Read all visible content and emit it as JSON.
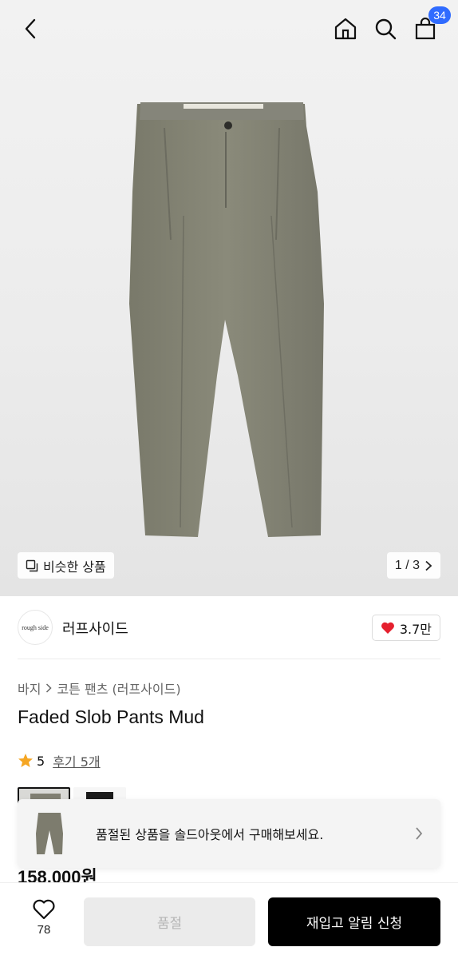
{
  "header": {
    "back_icon": "chevron-left-icon",
    "home_icon": "home-icon",
    "search_icon": "search-icon",
    "cart_icon": "shopping-bag-icon",
    "cart_count": "34"
  },
  "gallery": {
    "similar_label": "비슷한 상품",
    "page_indicator": "1 / 3"
  },
  "brand": {
    "logo_text": "rough side",
    "name": "러프사이드",
    "likes": "3.7만",
    "heart_color": "#e5202e"
  },
  "product": {
    "breadcrumb": [
      "바지",
      "코튼 팬츠 (러프사이드)"
    ],
    "title": "Faded Slob Pants Mud",
    "rating": "5",
    "reviews": "후기 5개",
    "price": "158,000원",
    "star_color": "#f5a623"
  },
  "banner": {
    "text": "품절된 상품을 솔드아웃에서 구매해보세요."
  },
  "bottom": {
    "wish_count": "78",
    "soldout_label": "품절",
    "restock_label": "재입고 알림 신청"
  }
}
